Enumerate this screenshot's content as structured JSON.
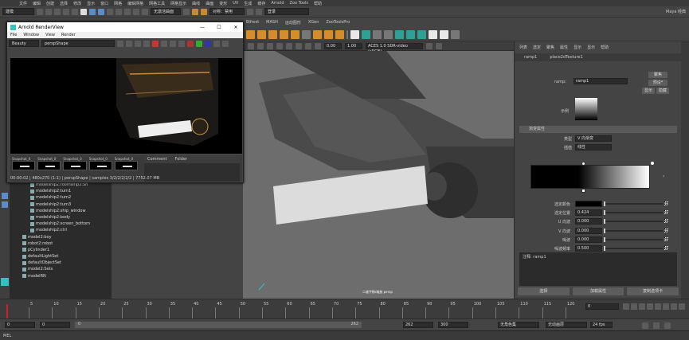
{
  "menubar": {
    "items": [
      "文件",
      "编辑",
      "创建",
      "选择",
      "修改",
      "显示",
      "窗口",
      "网格",
      "编辑网格",
      "网格工具",
      "网格显示",
      "曲线",
      "曲面",
      "变形",
      "UV",
      "生成",
      "缓存",
      "Arnold",
      "Zoo Tools",
      "帮助"
    ],
    "workspace": "Maya 经典"
  },
  "statusline": {
    "mode": "建模",
    "no_live": "无激活曲面",
    "symmetry": "对称：禁用",
    "login": "登录"
  },
  "shelf": {
    "tabs": [
      "Bifrost",
      "MASH",
      "运动图形",
      "XGen",
      "ZooToolsPro"
    ]
  },
  "renderview": {
    "title": "Arnold RenderView",
    "menu": [
      "File",
      "Window",
      "View",
      "Render"
    ],
    "aov": "Beauty",
    "camera": "perspShape",
    "exposure_left": "0.00",
    "exposure_right": "1.00",
    "colorspace": "ACES 1.0 SDR-video (sRGB)",
    "snapshots": [
      "Snapshot_0",
      "Snapshot_0",
      "Snapshot_0",
      "Snapshot_0",
      "Snapshot_0"
    ],
    "tabs": [
      "Comment",
      "Folder"
    ],
    "status": "00:00:02 | 480x270 (1:1) | perspShape  | samples 3/2/2/2/2/2 | 7752.07 MB"
  },
  "outliner": {
    "rows": [
      "modelship2:roomship3:Sh",
      "modelship2:turn1",
      "modelship2:turn2",
      "modelship2:turn3",
      "modelship2:ship_window",
      "modelship2:body",
      "modelship2:screen_bottom",
      "modelship2:ctrl",
      "model2:boy",
      "robot2:robot",
      "pCylinder1",
      "defaultLightSet",
      "defaultObjectSet",
      "model2:Sets",
      "modelRN"
    ]
  },
  "viewport": {
    "camera_label": "二维平移/缩放  persp"
  },
  "attr": {
    "tabs": [
      "列表",
      "选定",
      "聚焦",
      "属性",
      "显示",
      "显示",
      "帮助"
    ],
    "node_tabs": [
      "ramp1",
      "place2dTexture1"
    ],
    "ramp_label": "ramp:",
    "ramp_name": "ramp1",
    "focus_btn": "聚焦",
    "preset_btn": "预设*",
    "show_btn": "显示",
    "hide_btn": "隐藏",
    "sample_label": "示例",
    "section": "渐变属性",
    "type_label": "类型",
    "type_value": "V 向渐变",
    "interp_label": "插值",
    "interp_value": "线性",
    "fields": [
      {
        "label": "选定颜色",
        "value": ""
      },
      {
        "label": "选定位置",
        "value": "0.424"
      },
      {
        "label": "U 向波",
        "value": "0.000"
      },
      {
        "label": "V 向波",
        "value": "0.000"
      },
      {
        "label": "噪波",
        "value": "0.000"
      },
      {
        "label": "噪波频率",
        "value": "0.500"
      }
    ],
    "notes_label": "注释: ramp1",
    "buttons": [
      "选择",
      "加载属性",
      "复制选项卡"
    ]
  },
  "timeline": {
    "ticks": [
      "5",
      "10",
      "15",
      "20",
      "25",
      "30",
      "35",
      "40",
      "45",
      "50",
      "55",
      "60",
      "65",
      "70",
      "75",
      "80",
      "85",
      "90",
      "95",
      "100",
      "105",
      "110",
      "115",
      "120"
    ],
    "current": "0"
  },
  "range": {
    "start": "0",
    "start_inner": "0",
    "slider_start": "0",
    "slider_end": "262",
    "end_inner": "262",
    "end": "300",
    "no_char": "无角色集",
    "no_layer": "无动画层",
    "fps": "24 fps"
  },
  "cmdline": {
    "label": "MEL"
  },
  "colors": {
    "accent": "#3aa59a",
    "orange": "#d68c2a",
    "maya_teal": "#2fc4c4"
  }
}
